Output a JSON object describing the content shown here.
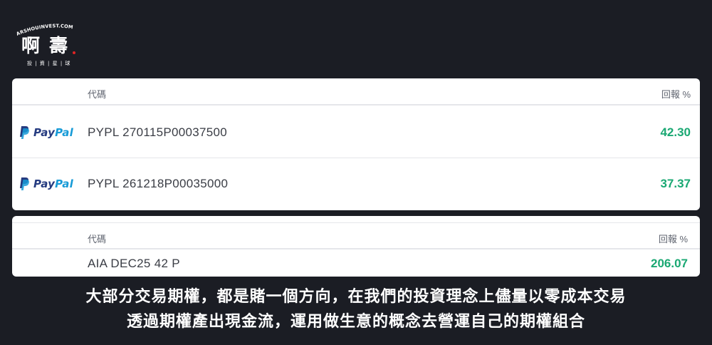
{
  "brand": {
    "domain": "ARSHOUINVEST.COM",
    "name": "啊 壽",
    "tagline": "投 | 資 | 星 | 球"
  },
  "table1": {
    "col_code": "代碼",
    "col_return": "回報 %",
    "rows": [
      {
        "logo_pay": "Pay",
        "logo_pal": "Pal",
        "code": "PYPL 270115P00037500",
        "return": "42.30"
      },
      {
        "logo_pay": "Pay",
        "logo_pal": "Pal",
        "code": "PYPL 261218P00035000",
        "return": "37.37"
      }
    ]
  },
  "table2": {
    "col_code": "代碼",
    "col_return": "回報 %",
    "rows": [
      {
        "code": "AIA DEC25 42 P",
        "return": "206.07"
      }
    ]
  },
  "caption": {
    "line1": "大部分交易期權，都是賭一個方向，在我們的投資理念上儘量以零成本交易",
    "line2": "透過期權產出現金流，運用做生意的概念去營運自己的期權組合"
  },
  "colors": {
    "background": "#1b1d24",
    "positive": "#1aa873",
    "paypal_dark": "#253b80",
    "paypal_light": "#179bd7"
  },
  "icons": [
    "paypal-logo-icon"
  ]
}
